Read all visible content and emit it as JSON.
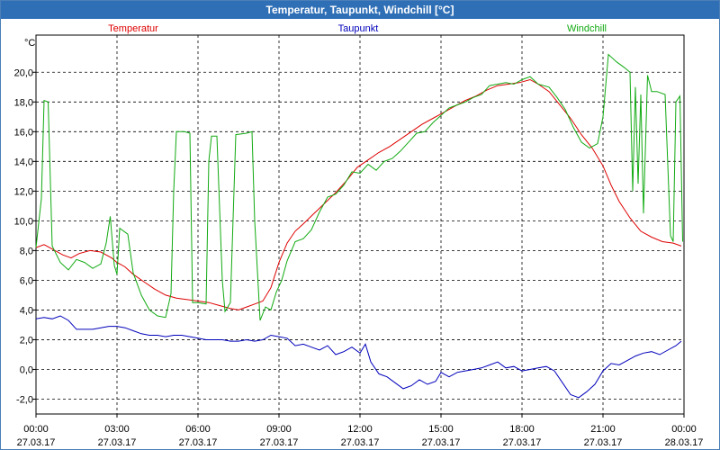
{
  "window": {
    "title": "Temperatur, Taupunkt, Windchill [°C]"
  },
  "colors": {
    "titlebar": "#2f6fb6",
    "temperatur": "#dd0000",
    "taupunkt": "#0000bb",
    "windchill": "#11aa11",
    "grid": "#000000"
  },
  "chart_data": {
    "type": "line",
    "title": "Temperatur, Taupunkt, Windchill [°C]",
    "ylabel": "°C",
    "xlabel": "",
    "ylim": [
      -3,
      22.5
    ],
    "xlim": [
      0,
      24
    ],
    "grid": true,
    "legend": "top",
    "y_ticks": [
      "-2,0",
      "0,0",
      "2,0",
      "4,0",
      "6,0",
      "8,0",
      "10,0",
      "12,0",
      "14,0",
      "16,0",
      "18,0",
      "20,0"
    ],
    "y_tick_values": [
      -2,
      0,
      2,
      4,
      6,
      8,
      10,
      12,
      14,
      16,
      18,
      20
    ],
    "x_ticks": [
      {
        "h": 0,
        "time": "00:00",
        "date": "27.03.17"
      },
      {
        "h": 3,
        "time": "03:00",
        "date": "27.03.17"
      },
      {
        "h": 6,
        "time": "06:00",
        "date": "27.03.17"
      },
      {
        "h": 9,
        "time": "09:00",
        "date": "27.03.17"
      },
      {
        "h": 12,
        "time": "12:00",
        "date": "27.03.17"
      },
      {
        "h": 15,
        "time": "15:00",
        "date": "27.03.17"
      },
      {
        "h": 18,
        "time": "18:00",
        "date": "27.03.17"
      },
      {
        "h": 21,
        "time": "21:00",
        "date": "27.03.17"
      },
      {
        "h": 24,
        "time": "00:00",
        "date": "28.03.17"
      }
    ],
    "series": [
      {
        "name": "Temperatur",
        "color": "#dd0000",
        "points": [
          [
            0,
            8.2
          ],
          [
            0.3,
            8.4
          ],
          [
            0.6,
            8.1
          ],
          [
            1.0,
            7.7
          ],
          [
            1.3,
            7.5
          ],
          [
            1.6,
            7.8
          ],
          [
            2.0,
            8.0
          ],
          [
            2.4,
            7.9
          ],
          [
            2.8,
            7.5
          ],
          [
            3.0,
            7.2
          ],
          [
            3.3,
            6.9
          ],
          [
            3.6,
            6.4
          ],
          [
            4.0,
            5.9
          ],
          [
            4.4,
            5.4
          ],
          [
            4.8,
            5.0
          ],
          [
            5.2,
            4.8
          ],
          [
            5.6,
            4.7
          ],
          [
            6.0,
            4.6
          ],
          [
            6.4,
            4.5
          ],
          [
            6.8,
            4.3
          ],
          [
            7.2,
            4.1
          ],
          [
            7.5,
            4.0
          ],
          [
            7.8,
            4.2
          ],
          [
            8.1,
            4.4
          ],
          [
            8.4,
            4.6
          ],
          [
            8.7,
            5.5
          ],
          [
            9.0,
            7.2
          ],
          [
            9.3,
            8.5
          ],
          [
            9.6,
            9.3
          ],
          [
            9.9,
            9.8
          ],
          [
            10.3,
            10.5
          ],
          [
            10.7,
            11.2
          ],
          [
            11.1,
            11.9
          ],
          [
            11.5,
            12.7
          ],
          [
            11.9,
            13.6
          ],
          [
            12.3,
            14.1
          ],
          [
            12.7,
            14.6
          ],
          [
            13.1,
            15.0
          ],
          [
            13.5,
            15.5
          ],
          [
            13.9,
            16.0
          ],
          [
            14.3,
            16.5
          ],
          [
            14.7,
            16.9
          ],
          [
            15.1,
            17.3
          ],
          [
            15.5,
            17.7
          ],
          [
            15.9,
            18.1
          ],
          [
            16.3,
            18.4
          ],
          [
            16.7,
            18.8
          ],
          [
            17.1,
            19.1
          ],
          [
            17.5,
            19.2
          ],
          [
            17.9,
            19.3
          ],
          [
            18.3,
            19.5
          ],
          [
            18.6,
            19.2
          ],
          [
            19.0,
            18.7
          ],
          [
            19.4,
            17.8
          ],
          [
            19.8,
            16.9
          ],
          [
            20.2,
            15.8
          ],
          [
            20.6,
            14.9
          ],
          [
            21.0,
            13.7
          ],
          [
            21.3,
            12.4
          ],
          [
            21.6,
            11.3
          ],
          [
            22.0,
            10.2
          ],
          [
            22.4,
            9.3
          ],
          [
            22.8,
            8.9
          ],
          [
            23.2,
            8.6
          ],
          [
            23.6,
            8.5
          ],
          [
            23.9,
            8.3
          ]
        ]
      },
      {
        "name": "Taupunkt",
        "color": "#0000bb",
        "points": [
          [
            0,
            3.4
          ],
          [
            0.3,
            3.5
          ],
          [
            0.6,
            3.4
          ],
          [
            0.9,
            3.6
          ],
          [
            1.2,
            3.3
          ],
          [
            1.5,
            2.7
          ],
          [
            1.8,
            2.7
          ],
          [
            2.1,
            2.7
          ],
          [
            2.4,
            2.8
          ],
          [
            2.7,
            2.9
          ],
          [
            3.0,
            2.9
          ],
          [
            3.3,
            2.8
          ],
          [
            3.6,
            2.6
          ],
          [
            3.9,
            2.4
          ],
          [
            4.2,
            2.3
          ],
          [
            4.5,
            2.3
          ],
          [
            4.8,
            2.2
          ],
          [
            5.1,
            2.3
          ],
          [
            5.4,
            2.3
          ],
          [
            5.7,
            2.2
          ],
          [
            6.0,
            2.1
          ],
          [
            6.3,
            2.0
          ],
          [
            6.6,
            2.0
          ],
          [
            6.9,
            2.0
          ],
          [
            7.2,
            1.9
          ],
          [
            7.5,
            1.9
          ],
          [
            7.8,
            2.0
          ],
          [
            8.1,
            1.9
          ],
          [
            8.4,
            2.0
          ],
          [
            8.7,
            2.3
          ],
          [
            9.0,
            2.2
          ],
          [
            9.3,
            2.1
          ],
          [
            9.6,
            1.6
          ],
          [
            9.9,
            1.7
          ],
          [
            10.2,
            1.5
          ],
          [
            10.5,
            1.3
          ],
          [
            10.8,
            1.6
          ],
          [
            11.1,
            1.0
          ],
          [
            11.4,
            1.2
          ],
          [
            11.7,
            1.5
          ],
          [
            12.0,
            1.1
          ],
          [
            12.2,
            1.7
          ],
          [
            12.4,
            0.5
          ],
          [
            12.7,
            -0.3
          ],
          [
            13.0,
            -0.5
          ],
          [
            13.3,
            -0.9
          ],
          [
            13.6,
            -1.3
          ],
          [
            13.9,
            -1.1
          ],
          [
            14.2,
            -0.7
          ],
          [
            14.5,
            -1.0
          ],
          [
            14.8,
            -0.8
          ],
          [
            15.0,
            -0.2
          ],
          [
            15.3,
            -0.5
          ],
          [
            15.6,
            -0.2
          ],
          [
            15.9,
            -0.1
          ],
          [
            16.2,
            0.0
          ],
          [
            16.5,
            0.1
          ],
          [
            16.8,
            0.3
          ],
          [
            17.1,
            0.5
          ],
          [
            17.4,
            0.1
          ],
          [
            17.7,
            0.2
          ],
          [
            18.0,
            -0.1
          ],
          [
            18.3,
            0.0
          ],
          [
            18.6,
            0.1
          ],
          [
            18.9,
            0.2
          ],
          [
            19.2,
            -0.1
          ],
          [
            19.5,
            -0.9
          ],
          [
            19.8,
            -1.7
          ],
          [
            20.1,
            -1.9
          ],
          [
            20.4,
            -1.5
          ],
          [
            20.7,
            -1.0
          ],
          [
            21.0,
            -0.1
          ],
          [
            21.3,
            0.4
          ],
          [
            21.6,
            0.3
          ],
          [
            21.9,
            0.6
          ],
          [
            22.2,
            0.9
          ],
          [
            22.5,
            1.1
          ],
          [
            22.8,
            1.2
          ],
          [
            23.1,
            1.0
          ],
          [
            23.4,
            1.3
          ],
          [
            23.7,
            1.6
          ],
          [
            23.9,
            1.9
          ]
        ]
      },
      {
        "name": "Windchill",
        "color": "#11aa11",
        "points": [
          [
            0,
            8.2
          ],
          [
            0.2,
            11.5
          ],
          [
            0.3,
            18.1
          ],
          [
            0.45,
            18.0
          ],
          [
            0.6,
            8.3
          ],
          [
            0.9,
            7.2
          ],
          [
            1.2,
            6.7
          ],
          [
            1.5,
            7.4
          ],
          [
            1.8,
            7.2
          ],
          [
            2.1,
            6.8
          ],
          [
            2.4,
            7.1
          ],
          [
            2.6,
            8.5
          ],
          [
            2.75,
            10.3
          ],
          [
            2.9,
            7.0
          ],
          [
            3.0,
            6.4
          ],
          [
            3.1,
            9.5
          ],
          [
            3.4,
            9.1
          ],
          [
            3.6,
            6.5
          ],
          [
            3.9,
            5.0
          ],
          [
            4.2,
            4.0
          ],
          [
            4.5,
            3.6
          ],
          [
            4.8,
            3.5
          ],
          [
            5.0,
            5.1
          ],
          [
            5.1,
            12.0
          ],
          [
            5.2,
            16.0
          ],
          [
            5.5,
            16.0
          ],
          [
            5.7,
            15.9
          ],
          [
            5.8,
            4.5
          ],
          [
            6.0,
            4.5
          ],
          [
            6.3,
            4.4
          ],
          [
            6.4,
            14.0
          ],
          [
            6.5,
            15.7
          ],
          [
            6.7,
            15.7
          ],
          [
            6.9,
            6.0
          ],
          [
            7.0,
            3.9
          ],
          [
            7.2,
            4.5
          ],
          [
            7.4,
            15.8
          ],
          [
            7.8,
            15.9
          ],
          [
            8.0,
            16.0
          ],
          [
            8.1,
            10.0
          ],
          [
            8.3,
            3.3
          ],
          [
            8.5,
            4.2
          ],
          [
            8.7,
            4.0
          ],
          [
            8.9,
            5.2
          ],
          [
            9.1,
            6.0
          ],
          [
            9.3,
            7.3
          ],
          [
            9.6,
            8.6
          ],
          [
            9.9,
            8.8
          ],
          [
            10.2,
            9.4
          ],
          [
            10.5,
            10.6
          ],
          [
            10.8,
            11.6
          ],
          [
            11.1,
            11.8
          ],
          [
            11.4,
            12.4
          ],
          [
            11.7,
            13.3
          ],
          [
            12.0,
            13.2
          ],
          [
            12.3,
            13.8
          ],
          [
            12.6,
            13.4
          ],
          [
            12.9,
            14.0
          ],
          [
            13.2,
            14.2
          ],
          [
            13.5,
            14.7
          ],
          [
            13.8,
            15.3
          ],
          [
            14.1,
            15.9
          ],
          [
            14.4,
            16.0
          ],
          [
            14.7,
            16.6
          ],
          [
            15.0,
            17.1
          ],
          [
            15.3,
            17.6
          ],
          [
            15.6,
            17.8
          ],
          [
            15.9,
            18.0
          ],
          [
            16.2,
            18.3
          ],
          [
            16.5,
            18.5
          ],
          [
            16.8,
            19.1
          ],
          [
            17.1,
            19.2
          ],
          [
            17.4,
            19.3
          ],
          [
            17.7,
            19.2
          ],
          [
            18.0,
            19.5
          ],
          [
            18.3,
            19.7
          ],
          [
            18.6,
            19.2
          ],
          [
            19.0,
            19.0
          ],
          [
            19.3,
            18.3
          ],
          [
            19.6,
            17.5
          ],
          [
            19.9,
            16.3
          ],
          [
            20.2,
            15.3
          ],
          [
            20.5,
            14.9
          ],
          [
            20.8,
            15.2
          ],
          [
            21.0,
            17.0
          ],
          [
            21.2,
            21.2
          ],
          [
            21.5,
            20.7
          ],
          [
            21.8,
            20.3
          ],
          [
            22.0,
            20.0
          ],
          [
            22.1,
            12.0
          ],
          [
            22.2,
            19.0
          ],
          [
            22.3,
            12.5
          ],
          [
            22.4,
            18.5
          ],
          [
            22.5,
            10.5
          ],
          [
            22.65,
            19.8
          ],
          [
            22.8,
            18.7
          ],
          [
            23.0,
            18.7
          ],
          [
            23.3,
            18.5
          ],
          [
            23.5,
            9.0
          ],
          [
            23.6,
            8.6
          ],
          [
            23.7,
            18.0
          ],
          [
            23.85,
            18.4
          ],
          [
            23.95,
            8.6
          ]
        ]
      }
    ]
  }
}
